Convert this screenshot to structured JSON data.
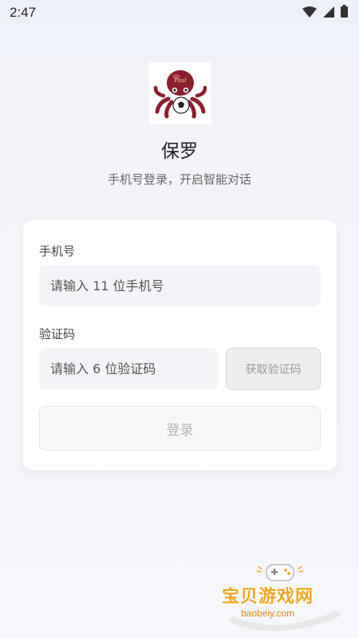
{
  "status_bar": {
    "time": "2:47"
  },
  "app": {
    "name": "保罗",
    "subtitle": "手机号登录，开启智能对话",
    "logo_icon": "octopus-soccer-logo",
    "logo_text": "Paul"
  },
  "form": {
    "phone_label": "手机号",
    "phone_placeholder": "请输入 11 位手机号",
    "phone_value": "",
    "code_label": "验证码",
    "code_placeholder": "请输入 6 位验证码",
    "code_value": "",
    "get_code_button": "获取验证码",
    "login_button": "登录"
  },
  "watermark": {
    "title": "宝贝游戏网",
    "url": "baobeiy.com"
  },
  "colors": {
    "card_background": "#ffffff",
    "input_background": "#f3f4f7",
    "logo_octopus": "#8b1e2d",
    "watermark_orange": "#f5a623"
  }
}
